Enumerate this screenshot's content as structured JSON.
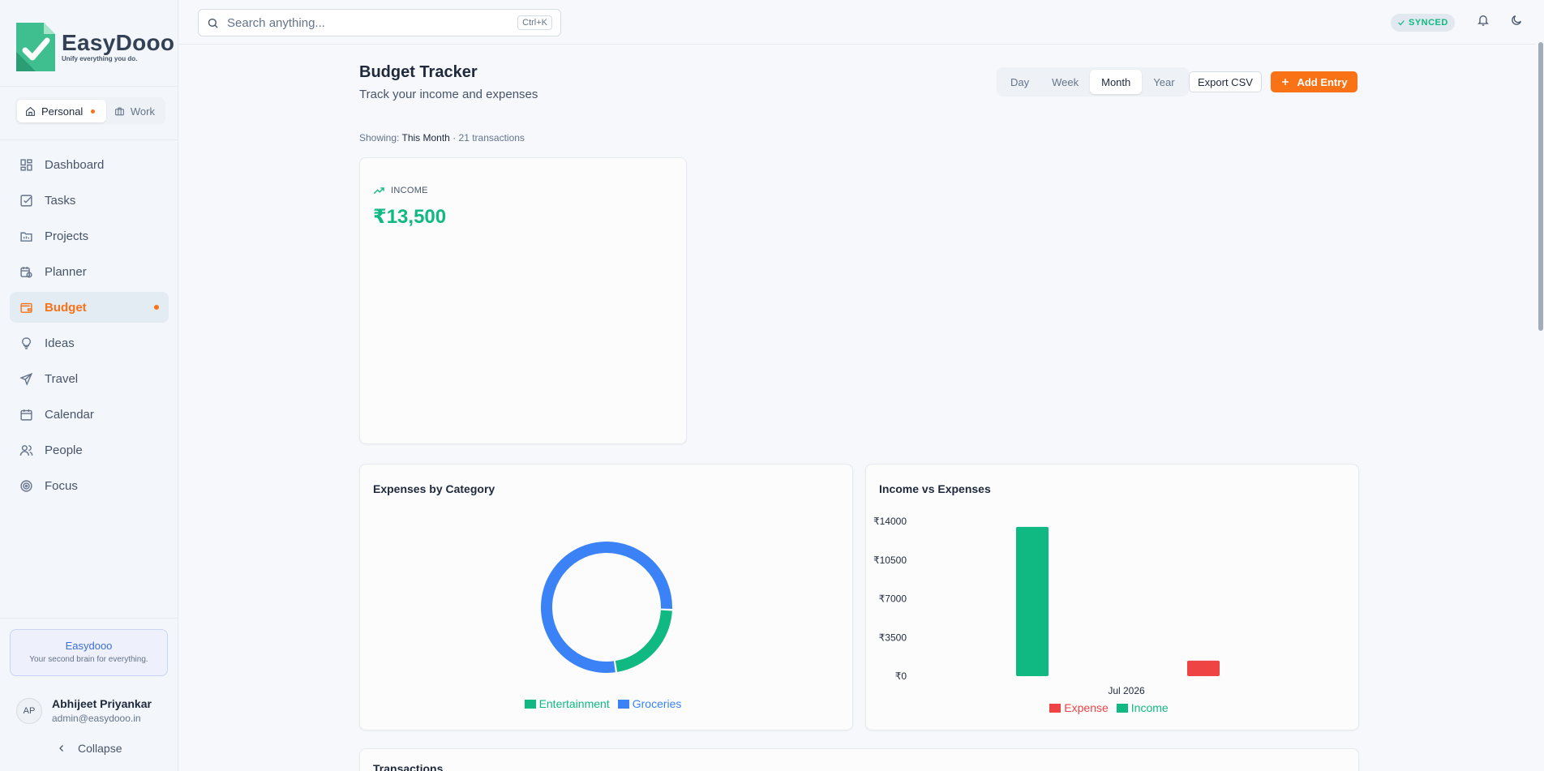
{
  "app": {
    "name": "EasyDooo",
    "tagline": "Unify everything you do."
  },
  "workspaces": [
    {
      "label": "Personal",
      "active": true
    },
    {
      "label": "Work",
      "active": false
    }
  ],
  "nav": [
    {
      "label": "Dashboard",
      "icon": "dashboard-icon"
    },
    {
      "label": "Tasks",
      "icon": "tasks-icon"
    },
    {
      "label": "Projects",
      "icon": "projects-icon"
    },
    {
      "label": "Planner",
      "icon": "planner-icon"
    },
    {
      "label": "Budget",
      "icon": "wallet-icon",
      "active": true
    },
    {
      "label": "Ideas",
      "icon": "lightbulb-icon"
    },
    {
      "label": "Travel",
      "icon": "plane-icon"
    },
    {
      "label": "Calendar",
      "icon": "calendar-icon"
    },
    {
      "label": "People",
      "icon": "people-icon"
    },
    {
      "label": "Focus",
      "icon": "target-icon"
    }
  ],
  "promo": {
    "title": "Easydooo",
    "subtitle": "Your second brain for everything."
  },
  "user": {
    "initials": "AP",
    "name": "Abhijeet Priyankar",
    "email": "admin@easydooo.in"
  },
  "collapse_label": "Collapse",
  "search": {
    "placeholder": "Search anything...",
    "shortcut": "Ctrl+K"
  },
  "status": {
    "synced": "SYNCED"
  },
  "page": {
    "title": "Budget Tracker",
    "subtitle": "Track your income and expenses",
    "periods": [
      "Day",
      "Week",
      "Month",
      "Year"
    ],
    "active_period": "Month",
    "export_label": "Export CSV",
    "add_label": "Add Entry",
    "showing_prefix": "Showing:",
    "showing_period": "This Month",
    "showing_count": "· 21 transactions"
  },
  "income": {
    "label": "INCOME",
    "value": "₹13,500"
  },
  "expenses_by_category": {
    "title": "Expenses by Category"
  },
  "income_vs_expenses": {
    "title": "Income vs Expenses"
  },
  "transactions": {
    "title": "Transactions"
  },
  "colors": {
    "accent": "#f97316",
    "income": "#10b981",
    "expense": "#ef4444",
    "groceries": "#3b82f6"
  },
  "chart_data": [
    {
      "type": "pie",
      "title": "Expenses by Category",
      "donut": true,
      "categories": [
        "Entertainment",
        "Groceries"
      ],
      "values": [
        22,
        78
      ],
      "colors": [
        "#10b981",
        "#3b82f6"
      ],
      "legend": "bottom"
    },
    {
      "type": "bar",
      "title": "Income vs Expenses",
      "categories": [
        "Jul 2026"
      ],
      "series": [
        {
          "name": "Income",
          "values": [
            13500
          ],
          "color": "#10b981"
        },
        {
          "name": "Expense",
          "values": [
            1400
          ],
          "color": "#ef4444"
        }
      ],
      "legend_order": [
        "Expense",
        "Income"
      ],
      "yticks": [
        "₹0",
        "₹3500",
        "₹7000",
        "₹10500",
        "₹14000"
      ],
      "ylim": [
        0,
        14000
      ],
      "legend": "bottom"
    }
  ]
}
